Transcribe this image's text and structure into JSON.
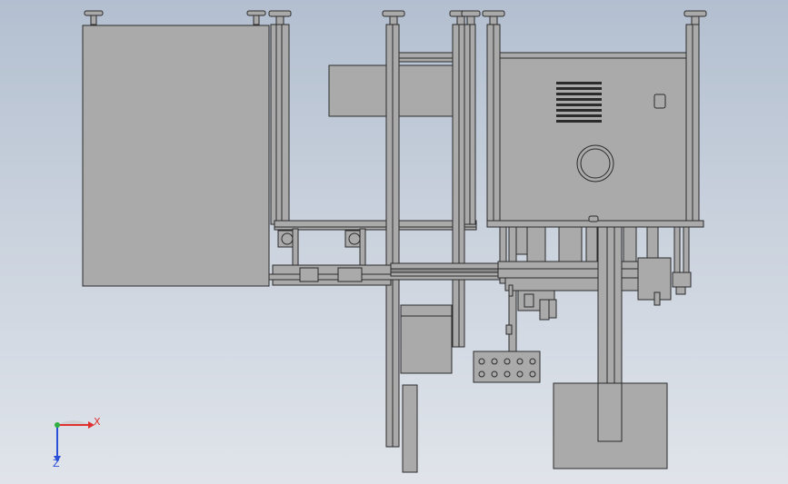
{
  "viewport": {
    "background_top": "#b3bfd0",
    "background_bottom": "#e0e4ea",
    "part_fill": "#aaaaaa",
    "part_edge": "#2b2b2b"
  },
  "triad": {
    "x_label": "X",
    "z_label": "Z",
    "x_color": "#e03030",
    "y_color": "#30b040",
    "z_color": "#2a4fd8"
  }
}
